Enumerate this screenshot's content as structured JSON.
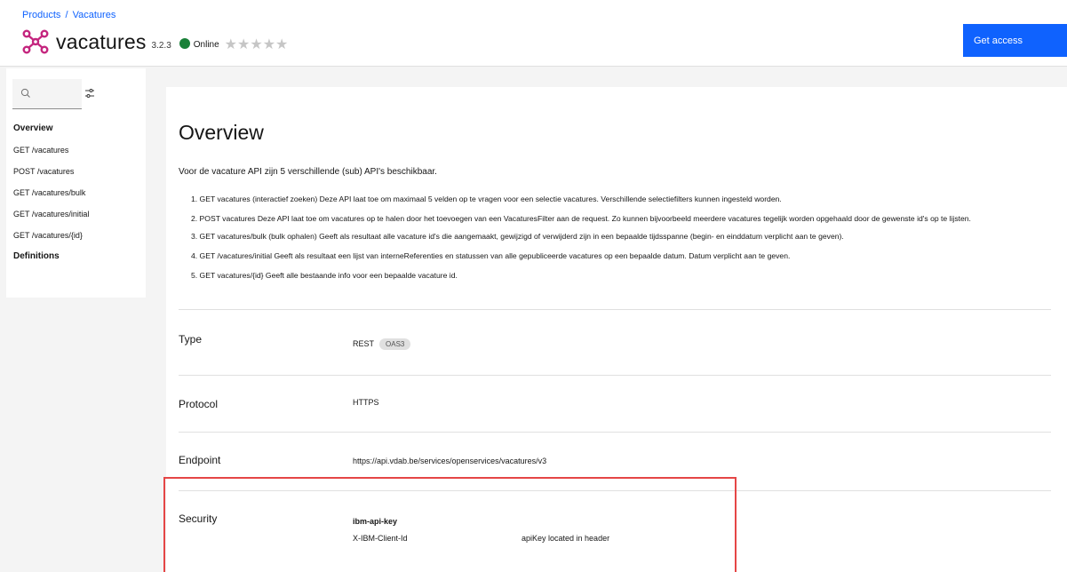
{
  "header": {
    "breadcrumb": {
      "parent": "Products",
      "separator": "/",
      "current": "Vacatures"
    },
    "api_name": "vacatures",
    "version": "3.2.3",
    "status": "Online",
    "status_color": "#198038",
    "rating_stars": "★★★★★",
    "rating": 0,
    "get_access_label": "Get access",
    "icon": "api-network-icon"
  },
  "sidebar": {
    "search_icon": "search-icon",
    "filter_icon": "filter-icon",
    "items": [
      {
        "label": "Overview"
      },
      {
        "label": "GET /vacatures"
      },
      {
        "label": "POST /vacatures"
      },
      {
        "label": "GET /vacatures/bulk"
      },
      {
        "label": "GET /vacatures/initial"
      },
      {
        "label": "GET /vacatures/{id}"
      },
      {
        "label": "Definitions"
      }
    ]
  },
  "main": {
    "title": "Overview",
    "intro": "Voor de vacature API zijn 5 verschillende (sub) API's beschikbaar.",
    "list": [
      "1. GET vacatures (interactief zoeken) Deze API laat toe om maximaal 5 velden op te vragen voor een selectie vacatures. Verschillende selectiefilters kunnen ingesteld worden.",
      "2. POST vacatures Deze API laat toe om vacatures op te halen door het toevoegen van een VacaturesFilter aan de request. Zo kunnen bijvoorbeeld meerdere vacatures tegelijk worden opgehaald door de gewenste id's op te lijsten.",
      "3. GET vacatures/bulk (bulk ophalen) Geeft als resultaat alle vacature id's die aangemaakt, gewijzigd of verwijderd zijn in een bepaalde tijdsspanne (begin- en einddatum verplicht aan te geven).",
      "4. GET /vacatures/initial Geeft als resultaat een lijst van interneReferenties en statussen van alle gepubliceerde vacatures op een bepaalde datum. Datum verplicht aan te geven.",
      "5. GET vacatures/{id} Geeft alle bestaande info voor een bepaalde vacature id."
    ],
    "type_label": "Type",
    "type_value": "REST",
    "type_badge": "OAS3",
    "protocol_label": "Protocol",
    "protocol_value": "HTTPS",
    "endpoint_label": "Endpoint",
    "endpoint_value": "https://api.vdab.be/services/openservices/vacatures/v3",
    "security_label": "Security",
    "security_scheme": "ibm-api-key",
    "security_header": "X-IBM-Client-Id",
    "security_desc": "apiKey located in header"
  },
  "colors": {
    "accent": "#0f62fe",
    "highlight": "#e54646",
    "brand_icon": "#c4257e"
  }
}
